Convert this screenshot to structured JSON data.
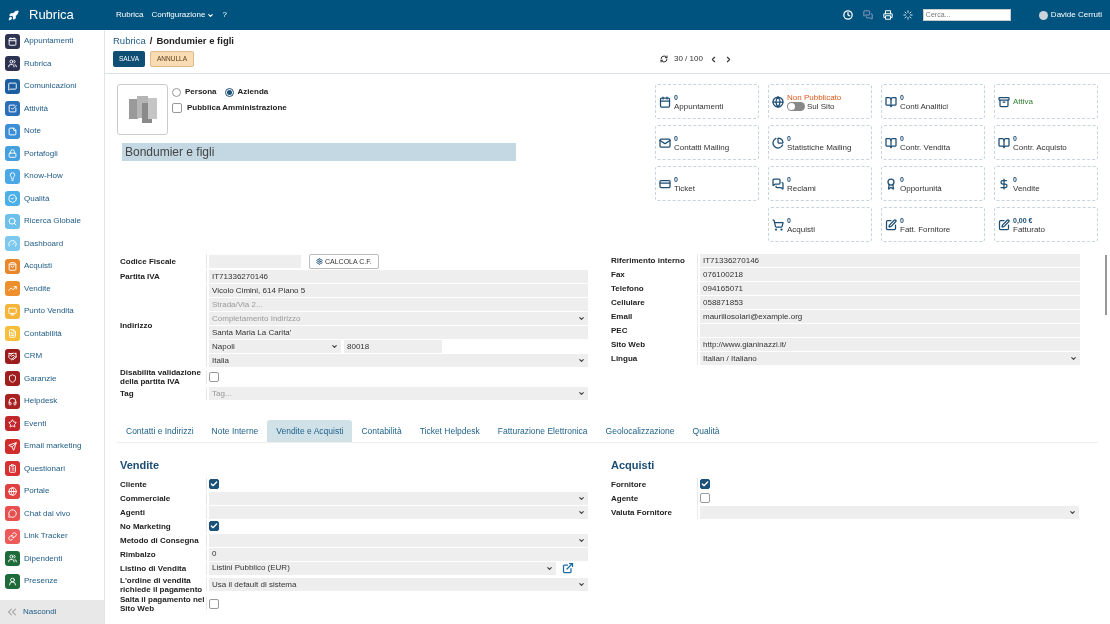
{
  "topbar": {
    "app_title": "Rubrica",
    "menu": [
      {
        "label": "Rubrica",
        "dropdown": false
      },
      {
        "label": "Configurazione",
        "dropdown": true
      },
      {
        "label": "?",
        "dropdown": false
      }
    ],
    "search": {
      "placeholder": "Cerca..."
    },
    "user": "Davide Cerruti"
  },
  "sidebar": {
    "items": [
      {
        "label": "Appuntamenti",
        "color": "#2d3250"
      },
      {
        "label": "Rubrica",
        "color": "#2d3250"
      },
      {
        "label": "Comunicazioni",
        "color": "#1c5fa0"
      },
      {
        "label": "Attività",
        "color": "#2a6fba"
      },
      {
        "label": "Note",
        "color": "#3a8fd8"
      },
      {
        "label": "Portafogli",
        "color": "#45a0e0"
      },
      {
        "label": "Know-How",
        "color": "#4aa8e6"
      },
      {
        "label": "Qualità",
        "color": "#4cb0e8"
      },
      {
        "label": "Ricerca Globale",
        "color": "#6cc0ea"
      },
      {
        "label": "Dashboard",
        "color": "#7cc8ee"
      },
      {
        "label": "Acquisti",
        "color": "#e8872a"
      },
      {
        "label": "Vendite",
        "color": "#ec8f2c"
      },
      {
        "label": "Punto Vendita",
        "color": "#f5b43a"
      },
      {
        "label": "Contabilità",
        "color": "#f7be3a"
      },
      {
        "label": "CRM",
        "color": "#9b1c1c"
      },
      {
        "label": "Garanzie",
        "color": "#a01e1e"
      },
      {
        "label": "Helpdesk",
        "color": "#a82020"
      },
      {
        "label": "Eventi",
        "color": "#c0262a"
      },
      {
        "label": "Email marketing",
        "color": "#d12c2c"
      },
      {
        "label": "Questionari",
        "color": "#d83030"
      },
      {
        "label": "Portale",
        "color": "#e04040"
      },
      {
        "label": "Chat dal vivo",
        "color": "#e85050"
      },
      {
        "label": "Link Tracker",
        "color": "#ee5a5a"
      },
      {
        "label": "Dipendenti",
        "color": "#1e6b3a"
      },
      {
        "label": "Presenze",
        "color": "#1e6b3a"
      }
    ],
    "collapse": "Nascondi"
  },
  "breadcrumb": {
    "parent": "Rubrica",
    "separator": "/",
    "current": "Bondumier e figli"
  },
  "buttons": [
    {
      "label": "SALVA",
      "kind": "primary"
    },
    {
      "label": "ANNULLA",
      "kind": "secondary"
    }
  ],
  "pager": "30 / 100",
  "entity_type": [
    {
      "label": "Persona",
      "selected": false
    },
    {
      "label": "Azienda",
      "selected": true
    }
  ],
  "public_admin": {
    "label": "Pubblica Amministrazione",
    "checked": false
  },
  "name": "Bondumier e figli",
  "smart_buttons": [
    [
      {
        "kind": "stat",
        "count": "0",
        "label": "Appuntamenti"
      },
      {
        "kind": "toggle",
        "status": "Non Pubblicato",
        "label": "Sul Sito",
        "on": false
      },
      {
        "kind": "stat",
        "count": "0",
        "label": "Conti Analitici"
      },
      {
        "kind": "status",
        "label": "Attiva"
      }
    ],
    [
      {
        "kind": "stat",
        "count": "0",
        "label": "Contatti Mailing"
      },
      {
        "kind": "stat",
        "count": "0",
        "label": "Statistiche Mailing"
      },
      {
        "kind": "stat",
        "count": "0",
        "label": "Contr. Vendita"
      },
      {
        "kind": "stat",
        "count": "0",
        "label": "Contr. Acquisto"
      }
    ],
    [
      {
        "kind": "stat",
        "count": "0",
        "label": "Ticket"
      },
      {
        "kind": "stat",
        "count": "0",
        "label": "Reclami"
      },
      {
        "kind": "stat",
        "count": "0",
        "label": "Opportunità"
      },
      {
        "kind": "stat",
        "count": "0",
        "label": "Vendite"
      }
    ],
    [
      {
        "kind": "stat",
        "count": "0",
        "label": "Acquisti"
      },
      {
        "kind": "stat",
        "count": "0",
        "label": "Fatt. Fornitore"
      },
      {
        "kind": "stat",
        "count": "0,00 €",
        "label": "Fatturato"
      }
    ]
  ],
  "left_fields": [
    {
      "label": "Codice Fiscale",
      "kind": "cf",
      "button": "CALCOLA C.F."
    },
    {
      "label": "Partita IVA",
      "kind": "text",
      "value": "IT71336270146"
    },
    {
      "label": "Indirizzo",
      "kind": "address",
      "street": "Vicolo Cimini, 614 Piano 5",
      "street2_placeholder": "Strada/Via 2...",
      "completion_placeholder": "Completamento Indirizzo",
      "locality": "Santa Maria La Carita'",
      "city": "Napoli",
      "zip": "80018",
      "country": "Italia"
    },
    {
      "label": "Disabilita validazione della partita IVA",
      "kind": "checkbox",
      "checked": false
    },
    {
      "label": "Tag",
      "kind": "tags",
      "placeholder": "Tag..."
    }
  ],
  "right_fields": [
    {
      "label": "Riferimento interno",
      "kind": "text",
      "value": "IT71336270146"
    },
    {
      "label": "Fax",
      "kind": "text",
      "value": "076100218"
    },
    {
      "label": "Telefono",
      "kind": "text",
      "value": "094165071"
    },
    {
      "label": "Cellulare",
      "kind": "text",
      "value": "058871853"
    },
    {
      "label": "Email",
      "kind": "text",
      "value": "mauriliosolari@example.org"
    },
    {
      "label": "PEC",
      "kind": "text"
    },
    {
      "label": "Sito Web",
      "kind": "text",
      "value": "http://www.gianinazzi.it/"
    },
    {
      "label": "Lingua",
      "kind": "select",
      "value": "Italian / Italiano"
    }
  ],
  "tabs": [
    {
      "label": "Contatti e Indirizzi",
      "selected": false
    },
    {
      "label": "Note Interne",
      "selected": false
    },
    {
      "label": "Vendite e Acquisti",
      "selected": true
    },
    {
      "label": "Contabilità",
      "selected": false
    },
    {
      "label": "Ticket Helpdesk",
      "selected": false
    },
    {
      "label": "Fatturazione Elettronica",
      "selected": false
    },
    {
      "label": "Geolocalizzazione",
      "selected": false
    },
    {
      "label": "Qualità",
      "selected": false
    }
  ],
  "sales": {
    "title": "Vendite",
    "fields": [
      {
        "label": "Cliente",
        "kind": "checkbox",
        "checked": true
      },
      {
        "label": "Commerciale",
        "kind": "select"
      },
      {
        "label": "Agenti",
        "kind": "select"
      },
      {
        "label": "No Marketing",
        "kind": "checkbox",
        "checked": true
      },
      {
        "label": "Metodo di Consegna",
        "kind": "select"
      },
      {
        "label": "Rimbalzo",
        "kind": "text",
        "value": "0"
      },
      {
        "label": "Listino di Vendita",
        "kind": "select_link",
        "value": "Listini Pubblico (EUR)"
      },
      {
        "label": "L'ordine di vendita richiede il pagamento",
        "kind": "select",
        "value": "Usa il default di sistema"
      },
      {
        "label": "Salta il pagamento nel Sito Web",
        "kind": "checkbox",
        "checked": false
      }
    ]
  },
  "purchases": {
    "title": "Acquisti",
    "fields": [
      {
        "label": "Fornitore",
        "kind": "checkbox",
        "checked": true
      },
      {
        "label": "Agente",
        "kind": "checkbox",
        "checked": false
      },
      {
        "label": "Valuta Fornitore",
        "kind": "select"
      }
    ]
  }
}
